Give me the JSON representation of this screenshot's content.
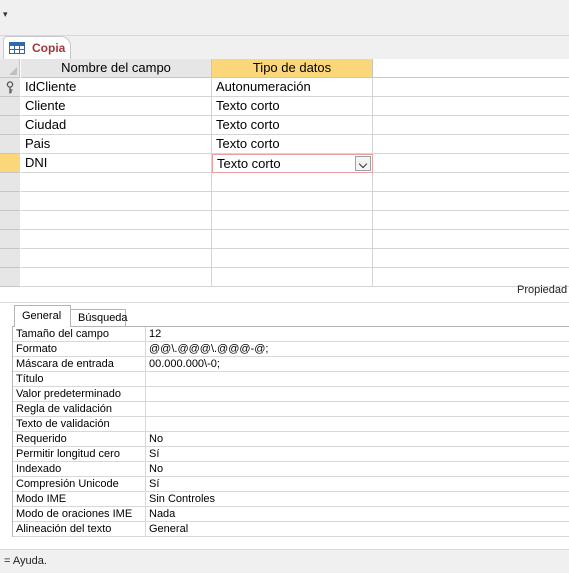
{
  "qat": {
    "customize_glyph": "▾"
  },
  "document_tab": {
    "label": "Copia",
    "icon": "table-icon"
  },
  "grid": {
    "headers": {
      "name": "Nombre del campo",
      "type": "Tipo de datos",
      "description": ""
    },
    "rows": [
      {
        "name": "IdCliente",
        "type": "Autonumeración",
        "description": "",
        "primary_key": true
      },
      {
        "name": "Cliente",
        "type": "Texto corto",
        "description": ""
      },
      {
        "name": "Ciudad",
        "type": "Texto corto",
        "description": ""
      },
      {
        "name": "Pais",
        "type": "Texto corto",
        "description": ""
      },
      {
        "name": "DNI",
        "type": "Texto corto",
        "description": "",
        "current": true
      }
    ]
  },
  "properties": {
    "label": "Propiedad",
    "tabs": [
      "General",
      "Búsqueda"
    ],
    "active_tab": "General",
    "rows": [
      {
        "label": "Tamaño del campo",
        "value": "12"
      },
      {
        "label": "Formato",
        "value": "@@\\.@@@\\.@@@-@;"
      },
      {
        "label": "Máscara de entrada",
        "value": "00.000.000\\-0;"
      },
      {
        "label": "Título",
        "value": ""
      },
      {
        "label": "Valor predeterminado",
        "value": ""
      },
      {
        "label": "Regla de validación",
        "value": ""
      },
      {
        "label": "Texto de validación",
        "value": ""
      },
      {
        "label": "Requerido",
        "value": "No"
      },
      {
        "label": "Permitir longitud cero",
        "value": "Sí"
      },
      {
        "label": "Indexado",
        "value": "No"
      },
      {
        "label": "Compresión Unicode",
        "value": "Sí"
      },
      {
        "label": "Modo IME",
        "value": "Sin Controles"
      },
      {
        "label": "Modo de oraciones IME",
        "value": "Nada"
      },
      {
        "label": "Alineación del texto",
        "value": "General"
      }
    ]
  },
  "status_bar": {
    "text": "= Ayuda."
  },
  "colors": {
    "header_active": "#fbd77a",
    "tab_text": "#a4373a",
    "active_cell_border": "#e8a1a3"
  }
}
